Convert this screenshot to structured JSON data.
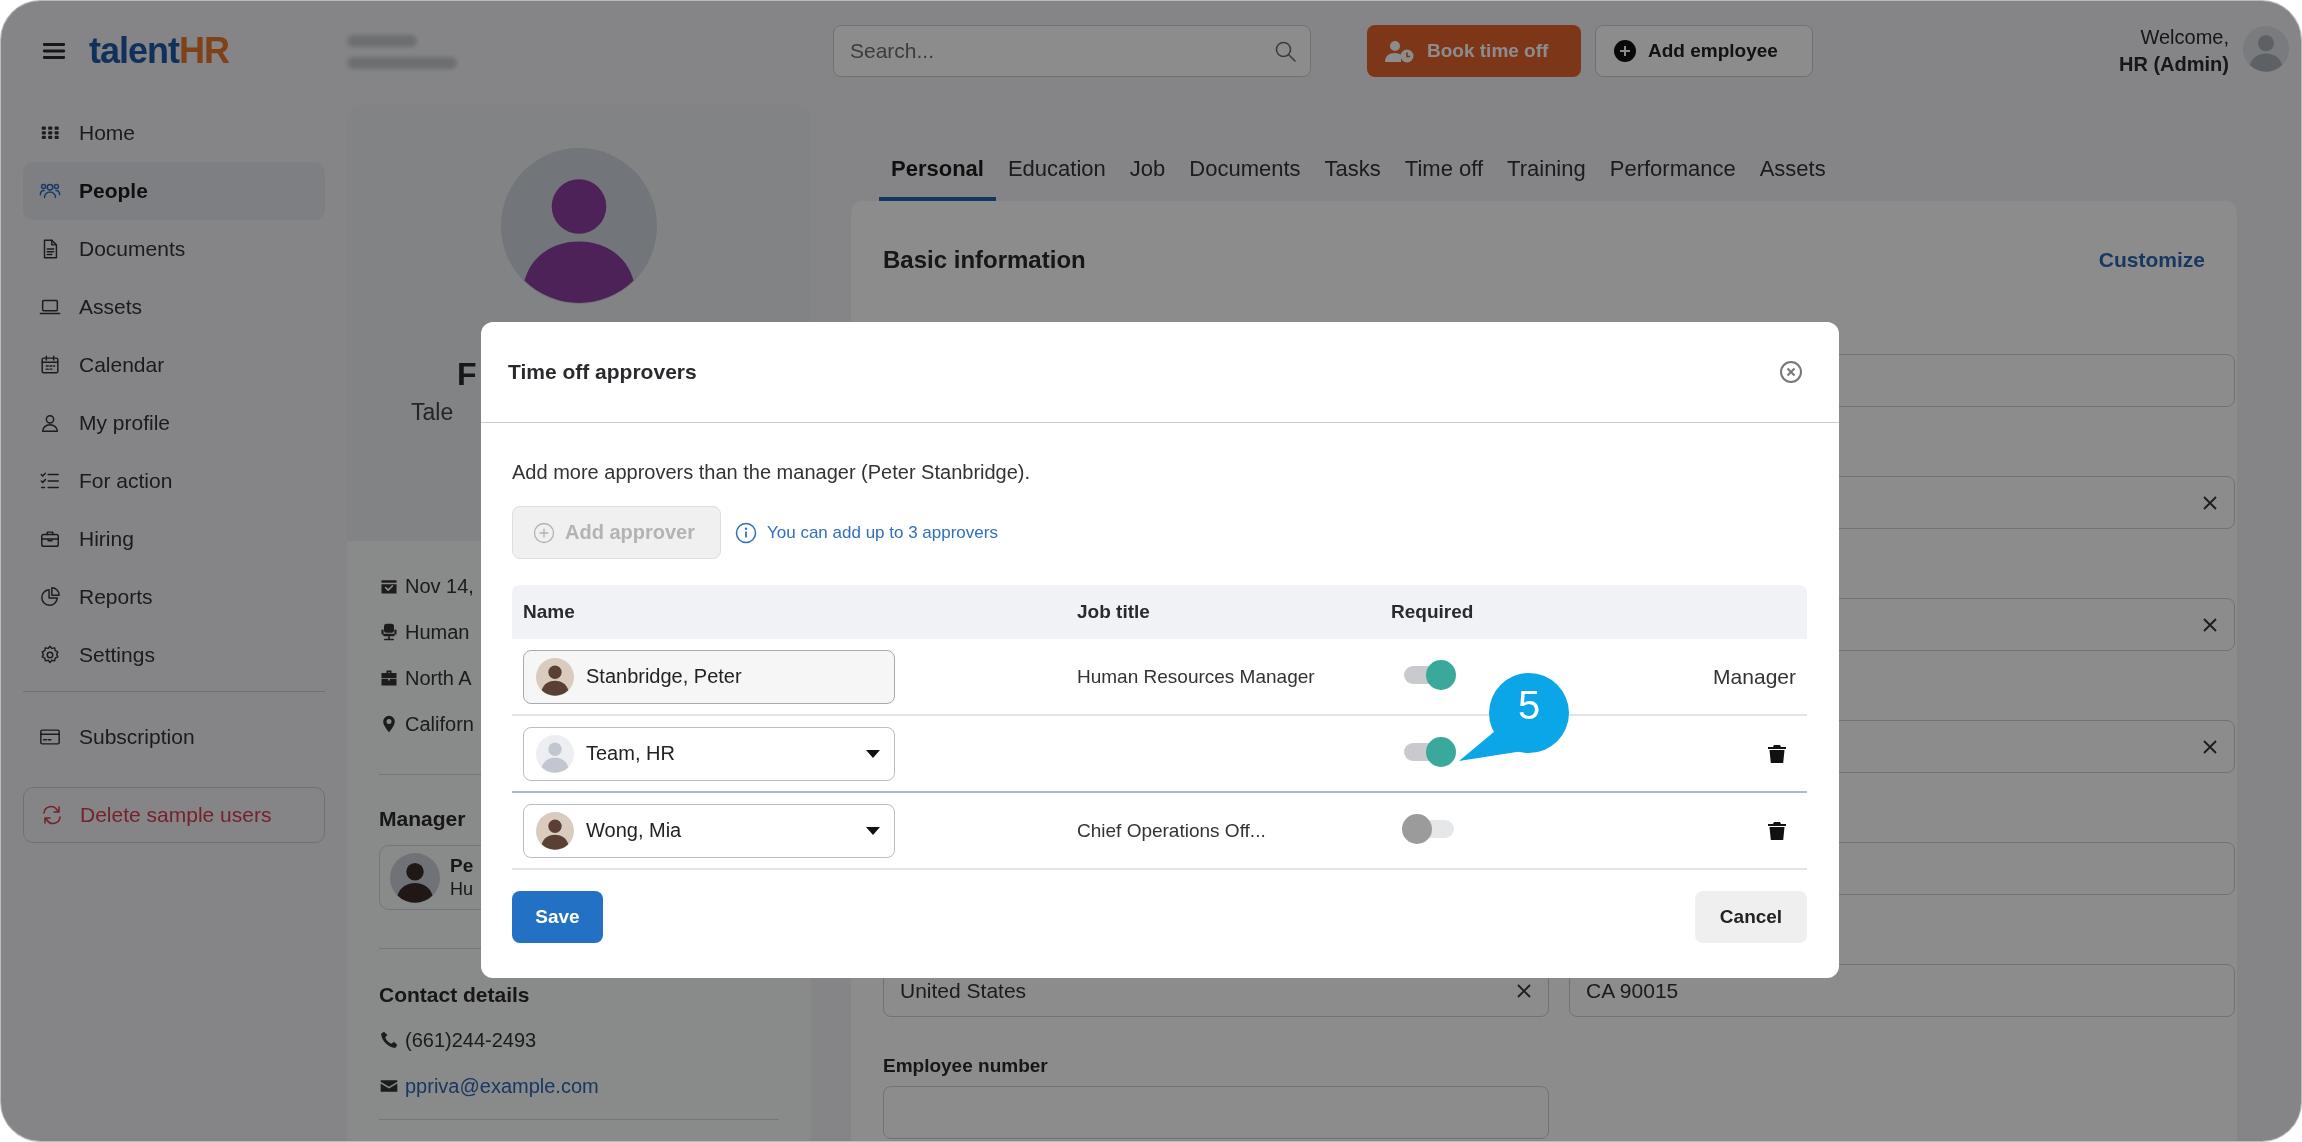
{
  "logo": {
    "text": "talent",
    "accent": "HR"
  },
  "header": {
    "search": {
      "placeholder": "Search..."
    },
    "actions": [
      {
        "label": "Book time off",
        "kind": "primary"
      },
      {
        "label": "Add employee",
        "kind": "secondary"
      }
    ],
    "welcome": "Welcome,",
    "user": "HR (Admin)"
  },
  "sidebar": {
    "items": [
      {
        "label": "Home",
        "selected": false
      },
      {
        "label": "People",
        "selected": true
      },
      {
        "label": "Documents",
        "selected": false
      },
      {
        "label": "Assets",
        "selected": false
      },
      {
        "label": "Calendar",
        "selected": false
      },
      {
        "label": "My profile",
        "selected": false
      },
      {
        "label": "For action",
        "selected": false
      },
      {
        "label": "Hiring",
        "selected": false
      },
      {
        "label": "Reports",
        "selected": false
      },
      {
        "label": "Settings",
        "selected": false
      }
    ],
    "footer_items": [
      {
        "label": "Subscription",
        "selected": false
      }
    ],
    "delete_button": "Delete sample users"
  },
  "profile": {
    "name": "F",
    "subtitle": "Tale",
    "details": [
      "Nov 14,",
      "Human",
      "North A",
      "Californ"
    ],
    "manager": {
      "title": "Manager",
      "name": "Pe",
      "role": "Hu"
    },
    "contact": {
      "title": "Contact details",
      "phone": "(661)244-2493",
      "email": "ppriva@example.com"
    }
  },
  "tabs": [
    {
      "label": "Personal",
      "selected": true
    },
    {
      "label": "Education",
      "selected": false
    },
    {
      "label": "Job",
      "selected": false
    },
    {
      "label": "Documents",
      "selected": false
    },
    {
      "label": "Tasks",
      "selected": false
    },
    {
      "label": "Time off",
      "selected": false
    },
    {
      "label": "Training",
      "selected": false
    },
    {
      "label": "Performance",
      "selected": false
    },
    {
      "label": "Assets",
      "selected": false
    }
  ],
  "form": {
    "title": "Basic information",
    "action": "Customize",
    "right_fields": [
      {
        "clear_button": false
      },
      {
        "clear_button": true
      },
      {
        "clear_button": true
      },
      {
        "clear_button": true
      },
      {
        "clear_button": false
      }
    ],
    "country": {
      "value": "United States",
      "clear_button": true
    },
    "postal_code": {
      "value": "CA 90015"
    },
    "employee_number": {
      "label": "Employee number"
    }
  },
  "dialog": {
    "title": "Time off approvers",
    "intro": "Add more approvers than the manager (Peter Stanbridge).",
    "add_button": {
      "label": "Add approver",
      "disabled": true
    },
    "hint": "You can add up to 3 approvers",
    "columns": [
      "Name",
      "Job title",
      "Required"
    ],
    "approvers": [
      {
        "kind": "manager",
        "name": "Stanbridge, Peter",
        "job_title": "Human Resources Manager",
        "required": true,
        "role": "Manager"
      },
      {
        "kind": "select",
        "name": "Team, HR",
        "required": true
      },
      {
        "kind": "select",
        "name": "Wong, Mia",
        "job_title": "Chief Operations Off...",
        "required": false
      }
    ],
    "save": "Save",
    "cancel": "Cancel"
  },
  "callout": {
    "label": "5"
  }
}
